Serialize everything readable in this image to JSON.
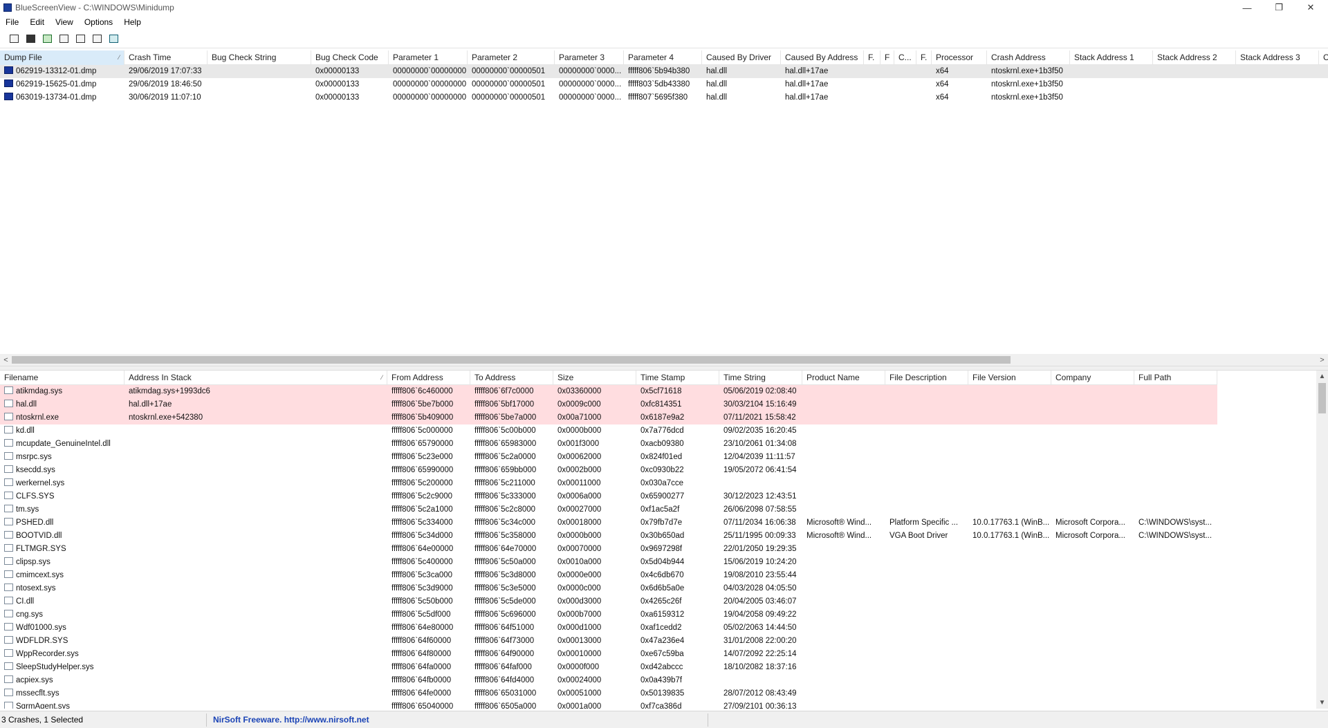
{
  "window": {
    "title": "BlueScreenView  -  C:\\WINDOWS\\Minidump",
    "minimize_glyph": "—",
    "restore_glyph": "❐",
    "close_glyph": "✕"
  },
  "menu": [
    "File",
    "Edit",
    "View",
    "Options",
    "Help"
  ],
  "toolbar": [
    "properties-icon",
    "save-icon",
    "refresh-icon",
    "copy-icon",
    "html-report-icon",
    "find-icon",
    "exit-icon"
  ],
  "crashes": {
    "columns": [
      "Dump File",
      "Crash Time",
      "Bug Check String",
      "Bug Check Code",
      "Parameter 1",
      "Parameter 2",
      "Parameter 3",
      "Parameter 4",
      "Caused By Driver",
      "Caused By Address",
      "F.",
      "F",
      "C...",
      "F.",
      "Processor",
      "Crash Address",
      "Stack Address 1",
      "Stack Address 2",
      "Stack Address 3",
      "Co"
    ],
    "sort_indicator": "⁄",
    "rows": [
      [
        "062919-13312-01.dmp",
        "29/06/2019 17:07:33",
        "",
        "0x00000133",
        "00000000`00000000",
        "00000000`00000501",
        "00000000`0000...",
        "fffff806`5b94b380",
        "hal.dll",
        "hal.dll+17ae",
        "",
        "",
        "",
        "",
        "x64",
        "ntoskrnl.exe+1b3f50",
        "",
        "",
        "",
        ""
      ],
      [
        "062919-15625-01.dmp",
        "29/06/2019 18:46:50",
        "",
        "0x00000133",
        "00000000`00000000",
        "00000000`00000501",
        "00000000`0000...",
        "fffff803`5db43380",
        "hal.dll",
        "hal.dll+17ae",
        "",
        "",
        "",
        "",
        "x64",
        "ntoskrnl.exe+1b3f50",
        "",
        "",
        "",
        ""
      ],
      [
        "063019-13734-01.dmp",
        "30/06/2019 11:07:10",
        "",
        "0x00000133",
        "00000000`00000000",
        "00000000`00000501",
        "00000000`0000...",
        "fffff807`5695f380",
        "hal.dll",
        "hal.dll+17ae",
        "",
        "",
        "",
        "",
        "x64",
        "ntoskrnl.exe+1b3f50",
        "",
        "",
        "",
        ""
      ]
    ]
  },
  "drivers": {
    "columns": [
      "Filename",
      "Address In Stack",
      "From Address",
      "To Address",
      "Size",
      "Time Stamp",
      "Time String",
      "Product Name",
      "File Description",
      "File Version",
      "Company",
      "Full Path"
    ],
    "sort_indicator": "⁄",
    "rows": [
      [
        "atikmdag.sys",
        "atikmdag.sys+1993dc6",
        "fffff806`6c460000",
        "fffff806`6f7c0000",
        "0x03360000",
        "0x5cf71618",
        "05/06/2019 02:08:40",
        "",
        "",
        "",
        "",
        ""
      ],
      [
        "hal.dll",
        "hal.dll+17ae",
        "fffff806`5be7b000",
        "fffff806`5bf17000",
        "0x0009c000",
        "0xfc814351",
        "30/03/2104 15:16:49",
        "",
        "",
        "",
        "",
        ""
      ],
      [
        "ntoskrnl.exe",
        "ntoskrnl.exe+542380",
        "fffff806`5b409000",
        "fffff806`5be7a000",
        "0x00a71000",
        "0x6187e9a2",
        "07/11/2021 15:58:42",
        "",
        "",
        "",
        "",
        ""
      ],
      [
        "kd.dll",
        "",
        "fffff806`5c000000",
        "fffff806`5c00b000",
        "0x0000b000",
        "0x7a776dcd",
        "09/02/2035 16:20:45",
        "",
        "",
        "",
        "",
        ""
      ],
      [
        "mcupdate_GenuineIntel.dll",
        "",
        "fffff806`65790000",
        "fffff806`65983000",
        "0x001f3000",
        "0xacb09380",
        "23/10/2061 01:34:08",
        "",
        "",
        "",
        "",
        ""
      ],
      [
        "msrpc.sys",
        "",
        "fffff806`5c23e000",
        "fffff806`5c2a0000",
        "0x00062000",
        "0x824f01ed",
        "12/04/2039 11:11:57",
        "",
        "",
        "",
        "",
        ""
      ],
      [
        "ksecdd.sys",
        "",
        "fffff806`65990000",
        "fffff806`659bb000",
        "0x0002b000",
        "0xc0930b22",
        "19/05/2072 06:41:54",
        "",
        "",
        "",
        "",
        ""
      ],
      [
        "werkernel.sys",
        "",
        "fffff806`5c200000",
        "fffff806`5c211000",
        "0x00011000",
        "0x030a7cce",
        "",
        "",
        "",
        "",
        "",
        ""
      ],
      [
        "CLFS.SYS",
        "",
        "fffff806`5c2c9000",
        "fffff806`5c333000",
        "0x0006a000",
        "0x65900277",
        "30/12/2023 12:43:51",
        "",
        "",
        "",
        "",
        ""
      ],
      [
        "tm.sys",
        "",
        "fffff806`5c2a1000",
        "fffff806`5c2c8000",
        "0x00027000",
        "0xf1ac5a2f",
        "26/06/2098 07:58:55",
        "",
        "",
        "",
        "",
        ""
      ],
      [
        "PSHED.dll",
        "",
        "fffff806`5c334000",
        "fffff806`5c34c000",
        "0x00018000",
        "0x79fb7d7e",
        "07/11/2034 16:06:38",
        "Microsoft® Wind...",
        "Platform Specific ...",
        "10.0.17763.1 (WinB...",
        "Microsoft Corpora...",
        "C:\\WINDOWS\\syst..."
      ],
      [
        "BOOTVID.dll",
        "",
        "fffff806`5c34d000",
        "fffff806`5c358000",
        "0x0000b000",
        "0x30b650ad",
        "25/11/1995 00:09:33",
        "Microsoft® Wind...",
        "VGA Boot Driver",
        "10.0.17763.1 (WinB...",
        "Microsoft Corpora...",
        "C:\\WINDOWS\\syst..."
      ],
      [
        "FLTMGR.SYS",
        "",
        "fffff806`64e00000",
        "fffff806`64e70000",
        "0x00070000",
        "0x9697298f",
        "22/01/2050 19:29:35",
        "",
        "",
        "",
        "",
        ""
      ],
      [
        "clipsp.sys",
        "",
        "fffff806`5c400000",
        "fffff806`5c50a000",
        "0x0010a000",
        "0x5d04b944",
        "15/06/2019 10:24:20",
        "",
        "",
        "",
        "",
        ""
      ],
      [
        "cmimcext.sys",
        "",
        "fffff806`5c3ca000",
        "fffff806`5c3d8000",
        "0x0000e000",
        "0x4c6db670",
        "19/08/2010 23:55:44",
        "",
        "",
        "",
        "",
        ""
      ],
      [
        "ntosext.sys",
        "",
        "fffff806`5c3d9000",
        "fffff806`5c3e5000",
        "0x0000c000",
        "0x6d6b5a0e",
        "04/03/2028 04:05:50",
        "",
        "",
        "",
        "",
        ""
      ],
      [
        "CI.dll",
        "",
        "fffff806`5c50b000",
        "fffff806`5c5de000",
        "0x000d3000",
        "0x4265c26f",
        "20/04/2005 03:46:07",
        "",
        "",
        "",
        "",
        ""
      ],
      [
        "cng.sys",
        "",
        "fffff806`5c5df000",
        "fffff806`5c696000",
        "0x000b7000",
        "0xa6159312",
        "19/04/2058 09:49:22",
        "",
        "",
        "",
        "",
        ""
      ],
      [
        "Wdf01000.sys",
        "",
        "fffff806`64e80000",
        "fffff806`64f51000",
        "0x000d1000",
        "0xaf1cedd2",
        "05/02/2063 14:44:50",
        "",
        "",
        "",
        "",
        ""
      ],
      [
        "WDFLDR.SYS",
        "",
        "fffff806`64f60000",
        "fffff806`64f73000",
        "0x00013000",
        "0x47a236e4",
        "31/01/2008 22:00:20",
        "",
        "",
        "",
        "",
        ""
      ],
      [
        "WppRecorder.sys",
        "",
        "fffff806`64f80000",
        "fffff806`64f90000",
        "0x00010000",
        "0xe67c59ba",
        "14/07/2092 22:25:14",
        "",
        "",
        "",
        "",
        ""
      ],
      [
        "SleepStudyHelper.sys",
        "",
        "fffff806`64fa0000",
        "fffff806`64faf000",
        "0x0000f000",
        "0xd42abccc",
        "18/10/2082 18:37:16",
        "",
        "",
        "",
        "",
        ""
      ],
      [
        "acpiex.sys",
        "",
        "fffff806`64fb0000",
        "fffff806`64fd4000",
        "0x00024000",
        "0x0a439b7f",
        "",
        "",
        "",
        "",
        "",
        ""
      ],
      [
        "mssecflt.sys",
        "",
        "fffff806`64fe0000",
        "fffff806`65031000",
        "0x00051000",
        "0x50139835",
        "28/07/2012 08:43:49",
        "",
        "",
        "",
        "",
        ""
      ],
      [
        "SgrmAgent.sys",
        "",
        "fffff806`65040000",
        "fffff806`6505a000",
        "0x0001a000",
        "0xf7ca386d",
        "27/09/2101 00:36:13",
        "",
        "",
        "",
        "",
        ""
      ]
    ]
  },
  "scrollbars": {
    "left": "<",
    "right": ">",
    "up": "▲",
    "down": "▼"
  },
  "status": {
    "count": "3 Crashes, 1 Selected",
    "brand": "NirSoft Freeware.  http://www.nirsoft.net"
  },
  "colors": {
    "highlight_row": "#ffdde0",
    "selected_row": "#e8e8e8",
    "sorted_header": "#d9ebf9",
    "brand_text": "#1a43b5"
  }
}
